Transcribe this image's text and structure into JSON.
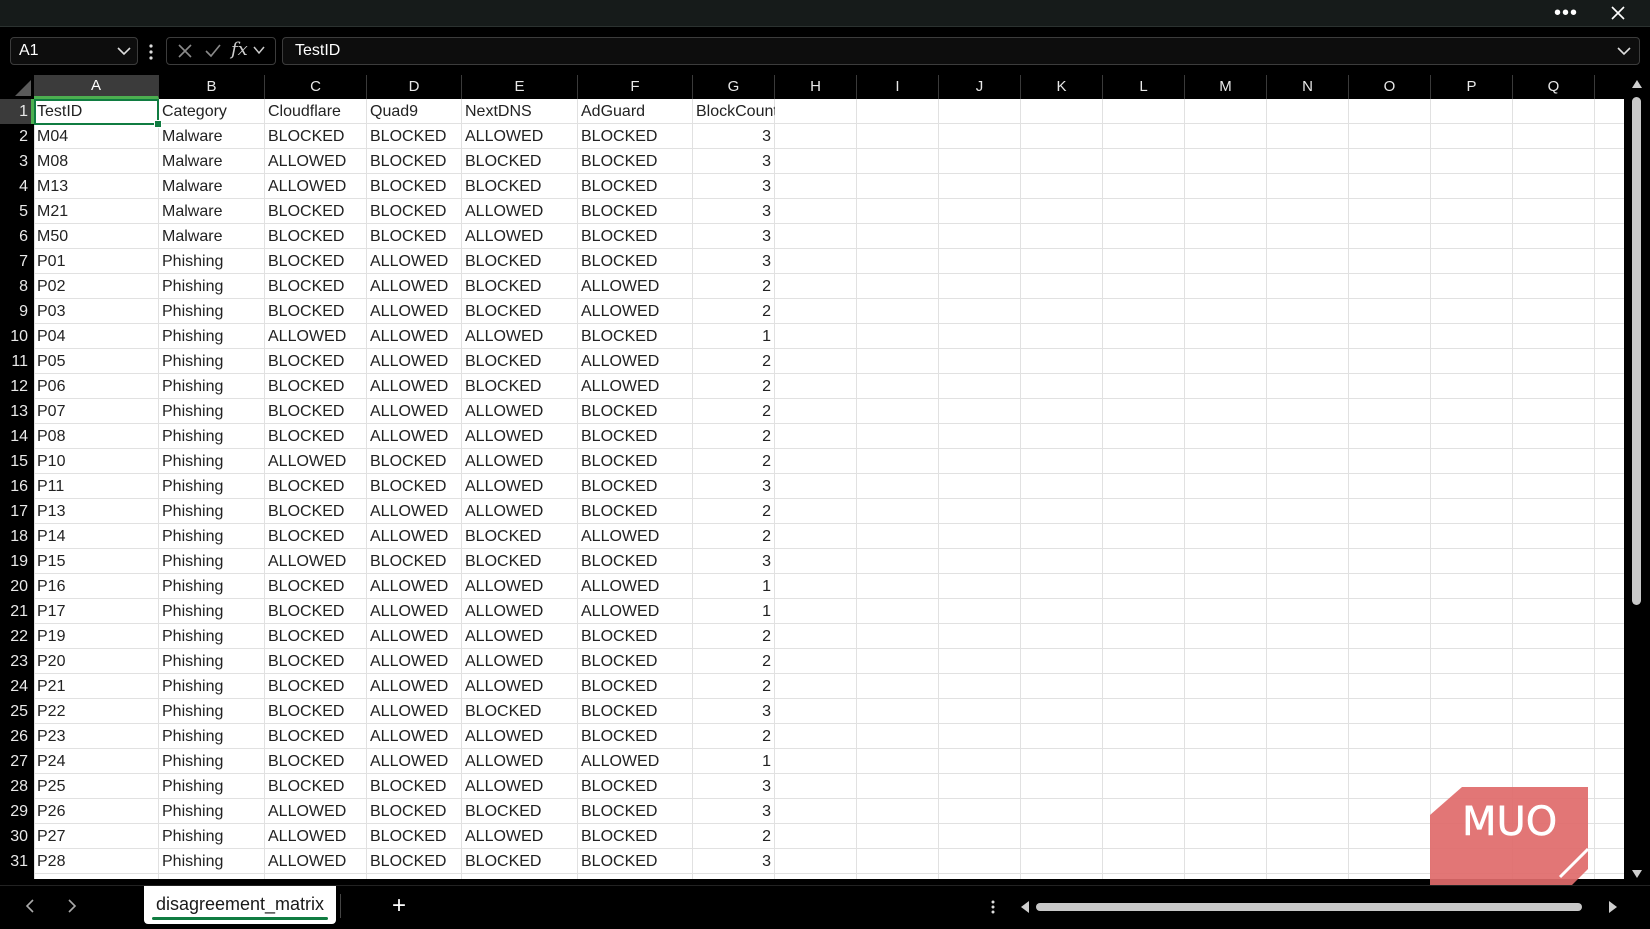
{
  "toolbar": {
    "more_icon": "more-horizontal-icon",
    "close_icon": "close-icon"
  },
  "formula_bar": {
    "name_box": "A1",
    "formula_label": "fx",
    "formula_value": "TestID"
  },
  "columns": [
    "A",
    "B",
    "C",
    "D",
    "E",
    "F",
    "G",
    "H",
    "I",
    "J",
    "K",
    "L",
    "M",
    "N",
    "O",
    "P",
    "Q"
  ],
  "rows": [
    "1",
    "2",
    "3",
    "4",
    "5",
    "6",
    "7",
    "8",
    "9",
    "10",
    "11",
    "12",
    "13",
    "14",
    "15",
    "16",
    "17",
    "18",
    "19",
    "20",
    "21",
    "22",
    "23",
    "24",
    "25",
    "26",
    "27",
    "28",
    "29",
    "30",
    "31"
  ],
  "selected_cell": "A1",
  "sheet": {
    "headers": [
      "TestID",
      "Category",
      "Cloudflare",
      "Quad9",
      "NextDNS",
      "AdGuard",
      "BlockCount"
    ],
    "data": [
      [
        "M04",
        "Malware",
        "BLOCKED",
        "BLOCKED",
        "ALLOWED",
        "BLOCKED",
        "3"
      ],
      [
        "M08",
        "Malware",
        "ALLOWED",
        "BLOCKED",
        "BLOCKED",
        "BLOCKED",
        "3"
      ],
      [
        "M13",
        "Malware",
        "ALLOWED",
        "BLOCKED",
        "BLOCKED",
        "BLOCKED",
        "3"
      ],
      [
        "M21",
        "Malware",
        "BLOCKED",
        "BLOCKED",
        "ALLOWED",
        "BLOCKED",
        "3"
      ],
      [
        "M50",
        "Malware",
        "BLOCKED",
        "BLOCKED",
        "ALLOWED",
        "BLOCKED",
        "3"
      ],
      [
        "P01",
        "Phishing",
        "BLOCKED",
        "ALLOWED",
        "BLOCKED",
        "BLOCKED",
        "3"
      ],
      [
        "P02",
        "Phishing",
        "BLOCKED",
        "ALLOWED",
        "BLOCKED",
        "ALLOWED",
        "2"
      ],
      [
        "P03",
        "Phishing",
        "BLOCKED",
        "ALLOWED",
        "BLOCKED",
        "ALLOWED",
        "2"
      ],
      [
        "P04",
        "Phishing",
        "ALLOWED",
        "ALLOWED",
        "ALLOWED",
        "BLOCKED",
        "1"
      ],
      [
        "P05",
        "Phishing",
        "BLOCKED",
        "ALLOWED",
        "BLOCKED",
        "ALLOWED",
        "2"
      ],
      [
        "P06",
        "Phishing",
        "BLOCKED",
        "ALLOWED",
        "BLOCKED",
        "ALLOWED",
        "2"
      ],
      [
        "P07",
        "Phishing",
        "BLOCKED",
        "ALLOWED",
        "ALLOWED",
        "BLOCKED",
        "2"
      ],
      [
        "P08",
        "Phishing",
        "BLOCKED",
        "ALLOWED",
        "ALLOWED",
        "BLOCKED",
        "2"
      ],
      [
        "P10",
        "Phishing",
        "ALLOWED",
        "BLOCKED",
        "ALLOWED",
        "BLOCKED",
        "2"
      ],
      [
        "P11",
        "Phishing",
        "BLOCKED",
        "BLOCKED",
        "ALLOWED",
        "BLOCKED",
        "3"
      ],
      [
        "P13",
        "Phishing",
        "BLOCKED",
        "ALLOWED",
        "ALLOWED",
        "BLOCKED",
        "2"
      ],
      [
        "P14",
        "Phishing",
        "BLOCKED",
        "ALLOWED",
        "BLOCKED",
        "ALLOWED",
        "2"
      ],
      [
        "P15",
        "Phishing",
        "ALLOWED",
        "BLOCKED",
        "BLOCKED",
        "BLOCKED",
        "3"
      ],
      [
        "P16",
        "Phishing",
        "BLOCKED",
        "ALLOWED",
        "ALLOWED",
        "ALLOWED",
        "1"
      ],
      [
        "P17",
        "Phishing",
        "BLOCKED",
        "ALLOWED",
        "ALLOWED",
        "ALLOWED",
        "1"
      ],
      [
        "P19",
        "Phishing",
        "BLOCKED",
        "ALLOWED",
        "ALLOWED",
        "BLOCKED",
        "2"
      ],
      [
        "P20",
        "Phishing",
        "BLOCKED",
        "ALLOWED",
        "ALLOWED",
        "BLOCKED",
        "2"
      ],
      [
        "P21",
        "Phishing",
        "BLOCKED",
        "ALLOWED",
        "ALLOWED",
        "BLOCKED",
        "2"
      ],
      [
        "P22",
        "Phishing",
        "BLOCKED",
        "ALLOWED",
        "BLOCKED",
        "BLOCKED",
        "3"
      ],
      [
        "P23",
        "Phishing",
        "BLOCKED",
        "ALLOWED",
        "ALLOWED",
        "BLOCKED",
        "2"
      ],
      [
        "P24",
        "Phishing",
        "BLOCKED",
        "ALLOWED",
        "ALLOWED",
        "ALLOWED",
        "1"
      ],
      [
        "P25",
        "Phishing",
        "BLOCKED",
        "BLOCKED",
        "ALLOWED",
        "BLOCKED",
        "3"
      ],
      [
        "P26",
        "Phishing",
        "ALLOWED",
        "BLOCKED",
        "BLOCKED",
        "BLOCKED",
        "3"
      ],
      [
        "P27",
        "Phishing",
        "ALLOWED",
        "BLOCKED",
        "ALLOWED",
        "BLOCKED",
        "2"
      ],
      [
        "P28",
        "Phishing",
        "ALLOWED",
        "BLOCKED",
        "BLOCKED",
        "BLOCKED",
        "3"
      ]
    ]
  },
  "sheet_tabs": {
    "active": "disagreement_matrix",
    "add_label": "+"
  },
  "watermark": {
    "text": "MUO",
    "color": "#e06a6a"
  },
  "colors": {
    "accent": "#107c41",
    "header_bg": "#000000",
    "cell_bg": "#ffffff"
  }
}
